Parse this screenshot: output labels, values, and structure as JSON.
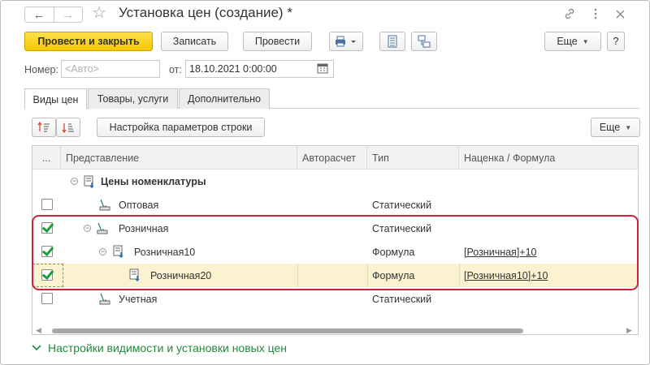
{
  "window": {
    "title": "Установка цен (создание) *"
  },
  "toolbar": {
    "post_close_label": "Провести и закрыть",
    "save_label": "Записать",
    "post_label": "Провести",
    "more_label": "Еще",
    "help_label": "?"
  },
  "header": {
    "number_label": "Номер:",
    "number_placeholder": "<Авто>",
    "date_label": "от:",
    "date_value": "18.10.2021  0:00:00"
  },
  "tabs": [
    {
      "label": "Виды цен",
      "active": true
    },
    {
      "label": "Товары, услуги",
      "active": false
    },
    {
      "label": "Дополнительно",
      "active": false
    }
  ],
  "grid_toolbar": {
    "row_params_label": "Настройка параметров строки",
    "more_label": "Еще"
  },
  "grid": {
    "columns": [
      "...",
      "Представление",
      "Авторасчет",
      "Тип",
      "Наценка / Формула"
    ],
    "rows": [
      {
        "name": "Цены номенклатуры",
        "checked": null,
        "type": "",
        "formula": "",
        "group": true
      },
      {
        "name": "Оптовая",
        "checked": false,
        "type": "Статический",
        "formula": ""
      },
      {
        "name": "Розничная",
        "checked": true,
        "type": "Статический",
        "formula": ""
      },
      {
        "name": "Розничная10",
        "checked": true,
        "type": "Формула",
        "formula": "[Розничная]+10"
      },
      {
        "name": "Розничная20",
        "checked": true,
        "type": "Формула",
        "formula": "[Розничная10]+10",
        "selected": true
      },
      {
        "name": "Учетная",
        "checked": false,
        "type": "Статический",
        "formula": ""
      }
    ]
  },
  "footer": {
    "section_label": "Настройки видимости и установки новых цен"
  },
  "colors": {
    "accent_yellow": "#f5c800",
    "highlight_red": "#d0213c",
    "check_green": "#1c9e3c",
    "footer_green": "#1f8a3a",
    "selected_row": "#fbf3cf"
  }
}
